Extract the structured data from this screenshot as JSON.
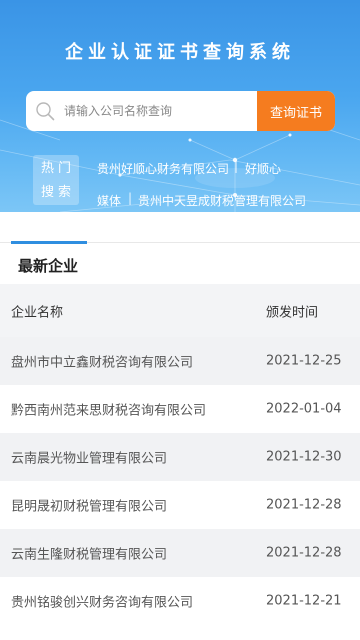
{
  "header": {
    "title": "企业认证证书查询系统"
  },
  "search": {
    "placeholder": "请输入公司名称查询",
    "button_label": "查询证书"
  },
  "hot_search": {
    "label_line1": "热门",
    "label_line2": "搜索",
    "row1": [
      "贵州好顺心财务有限公司",
      "好顺心"
    ],
    "row2": [
      "媒体",
      "贵州中天昱成财税管理有限公司"
    ],
    "separator": "|"
  },
  "tab": {
    "label": "最新企业"
  },
  "table": {
    "columns": [
      "企业名称",
      "颁发时间"
    ],
    "rows": [
      [
        "盘州市中立鑫财税咨询有限公司",
        "2021-12-25"
      ],
      [
        "黔西南州范来思财税咨询有限公司",
        "2022-01-04"
      ],
      [
        "云南晨光物业管理有限公司",
        "2021-12-30"
      ],
      [
        "昆明晟初财税管理有限公司",
        "2021-12-28"
      ],
      [
        "云南生隆财税管理有限公司",
        "2021-12-28"
      ],
      [
        "贵州铭骏创兴财务咨询有限公司",
        "2021-12-21"
      ]
    ]
  },
  "colors": {
    "header_blue": "#3a94e6",
    "button_orange": "#f57c1f",
    "tab_accent": "#2f8ee0"
  }
}
